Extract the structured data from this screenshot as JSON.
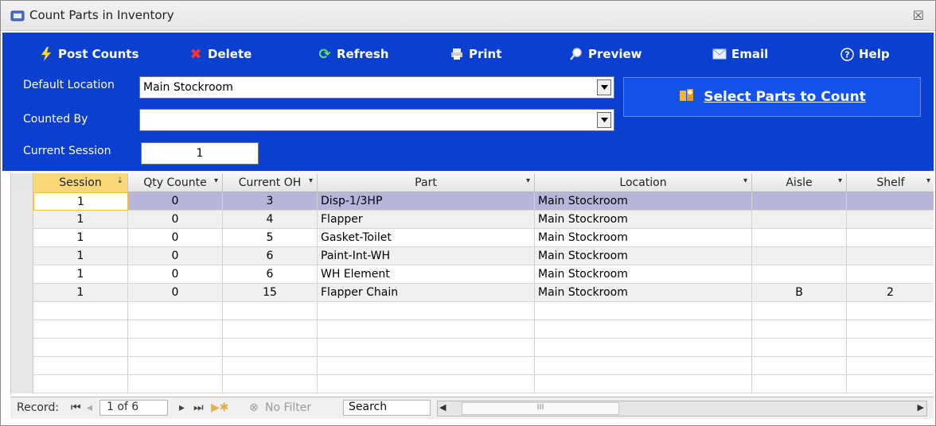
{
  "window": {
    "title": "Count Parts in Inventory"
  },
  "toolbar": {
    "post_counts": "Post Counts",
    "delete": "Delete",
    "refresh": "Refresh",
    "print": "Print",
    "preview": "Preview",
    "email": "Email",
    "help": "Help"
  },
  "form": {
    "default_location_label": "Default Location",
    "default_location_value": "Main Stockroom",
    "counted_by_label": "Counted By",
    "counted_by_value": "",
    "current_session_label": "Current Session",
    "current_session_value": "1",
    "select_parts_button": "Select Parts to Count"
  },
  "grid": {
    "columns": [
      "Session",
      "Qty Counte",
      "Current OH",
      "Part",
      "Location",
      "Aisle",
      "Shelf"
    ],
    "rows": [
      {
        "session": "1",
        "qty": "0",
        "oh": "3",
        "part": "Disp-1/3HP",
        "location": "Main Stockroom",
        "aisle": "",
        "shelf": ""
      },
      {
        "session": "1",
        "qty": "0",
        "oh": "4",
        "part": "Flapper",
        "location": "Main Stockroom",
        "aisle": "",
        "shelf": ""
      },
      {
        "session": "1",
        "qty": "0",
        "oh": "5",
        "part": "Gasket-Toilet",
        "location": "Main Stockroom",
        "aisle": "",
        "shelf": ""
      },
      {
        "session": "1",
        "qty": "0",
        "oh": "6",
        "part": "Paint-Int-WH",
        "location": "Main Stockroom",
        "aisle": "",
        "shelf": ""
      },
      {
        "session": "1",
        "qty": "0",
        "oh": "6",
        "part": "WH Element",
        "location": "Main Stockroom",
        "aisle": "",
        "shelf": ""
      },
      {
        "session": "1",
        "qty": "0",
        "oh": "15",
        "part": "Flapper Chain",
        "location": "Main Stockroom",
        "aisle": "B",
        "shelf": "2"
      }
    ]
  },
  "nav": {
    "record_label": "Record:",
    "position": "1 of 6",
    "filter": "No Filter",
    "search_placeholder": "Search",
    "scroll_grip": "III"
  },
  "colors": {
    "panel": "#0b3fcf",
    "select_button": "#1552ea",
    "selected_row": "#b7b5d9",
    "sorted_header": "#f9d877"
  }
}
